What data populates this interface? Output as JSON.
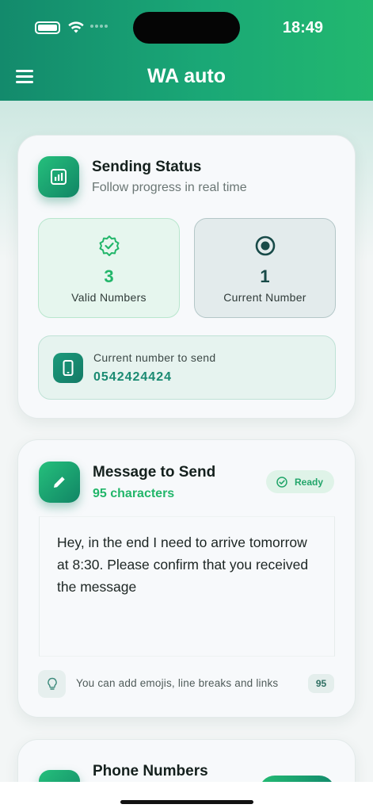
{
  "status_bar": {
    "time": "18:49"
  },
  "header": {
    "title": "WA auto",
    "menu_icon": "hamburger-menu-icon"
  },
  "sending_status": {
    "title": "Sending Status",
    "subtitle": "Follow progress in real time",
    "icon": "chart-icon",
    "valid": {
      "count": "3",
      "label": "Valid Numbers",
      "icon": "verified-badge-icon"
    },
    "current": {
      "count": "1",
      "label": "Current Number",
      "icon": "radio-target-icon"
    },
    "current_number": {
      "label": "Current number to send",
      "value": "0542424424",
      "icon": "smartphone-icon"
    }
  },
  "message": {
    "title": "Message to Send",
    "subtitle": "95 characters",
    "icon": "pencil-icon",
    "badge": "Ready",
    "text": "Hey, in the end I need to arrive tomorrow at 8:30. Please confirm that you received the message",
    "tip": "You can add emojis, line breaks and links",
    "tip_icon": "lightbulb-icon",
    "char_count": "95"
  },
  "phone_numbers": {
    "title": "Phone Numbers"
  },
  "colors": {
    "accent": "#1aa876",
    "accent_dark": "#118565",
    "valid_green": "#22b66a",
    "current_dark": "#184a48"
  }
}
